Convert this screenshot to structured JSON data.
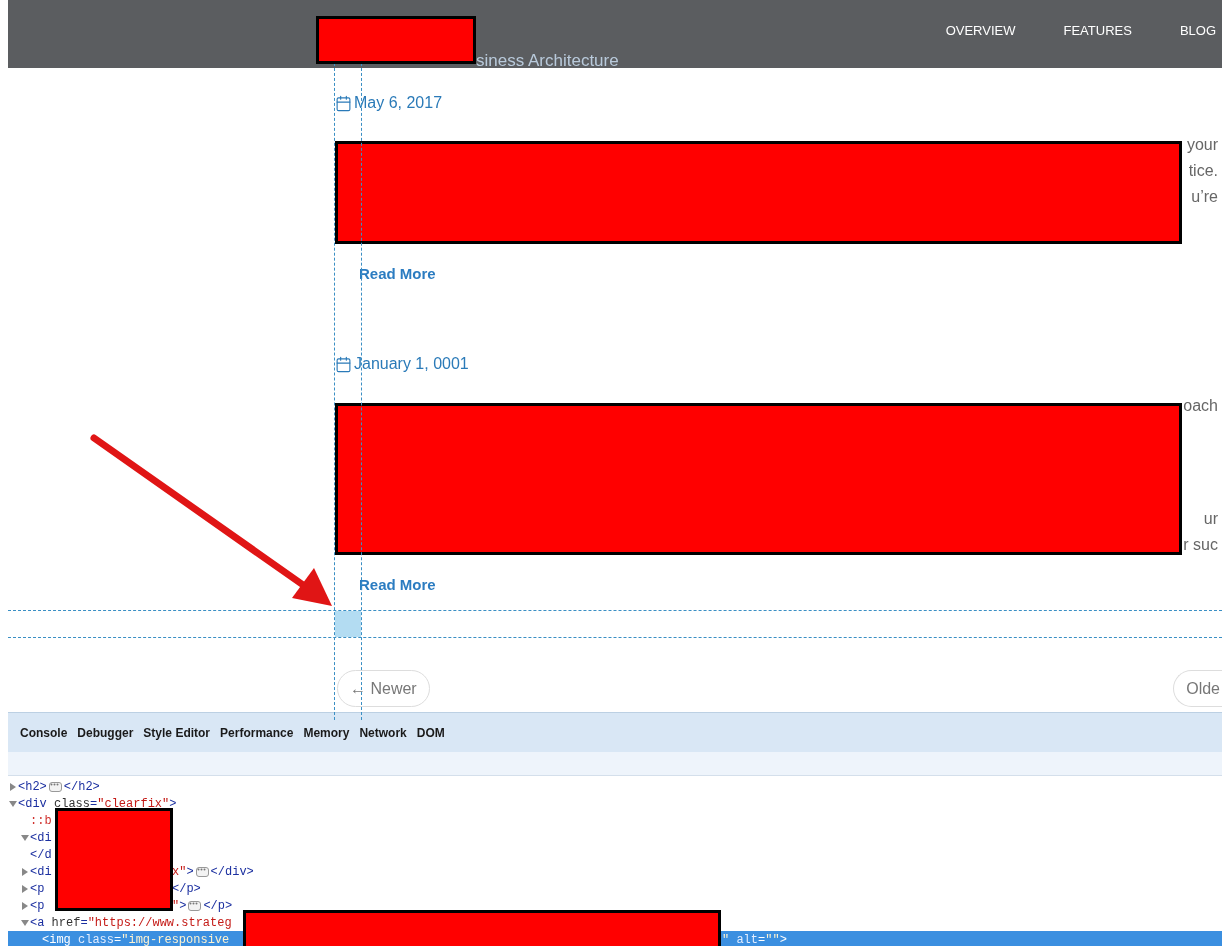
{
  "header": {
    "nav": [
      {
        "label": "OVERVIEW"
      },
      {
        "label": "FEATURES"
      },
      {
        "label": "BLOG"
      }
    ]
  },
  "title_fragment": "siness Architecture",
  "posts": [
    {
      "date": "May 6, 2017",
      "fragment_groups": [
        [
          "your",
          "tice.",
          "u’re"
        ]
      ],
      "read_more": "Read More"
    },
    {
      "date": "January 1, 0001",
      "fragment_groups": [
        [
          "oach"
        ],
        [
          "ur",
          "r suc"
        ]
      ],
      "read_more": "Read More"
    }
  ],
  "pager": {
    "newer": "← Newer",
    "older": "Olde"
  },
  "devtools": {
    "tabs": [
      "Console",
      "Debugger",
      "Style Editor",
      "Performance",
      "Memory",
      "Network",
      "DOM"
    ],
    "lines": [
      {
        "expanded": false,
        "selected": false,
        "head": [
          {
            "kind": "tag",
            "text": "<h2>"
          },
          {
            "kind": "ellipsis"
          },
          {
            "kind": "tag",
            "text": "</h2>"
          }
        ]
      },
      {
        "expanded": true,
        "selected": false,
        "head": [
          {
            "kind": "tag",
            "text": "<div "
          },
          {
            "kind": "attr",
            "text": "class"
          },
          {
            "kind": "tag",
            "text": "="
          },
          {
            "kind": "value",
            "text": "\"clearfix\""
          },
          {
            "kind": "tag",
            "text": ">"
          }
        ],
        "children": [
          {
            "selected": false,
            "head": [
              {
                "kind": "pseudo",
                "text": "::b"
              }
            ]
          },
          {
            "expanded": true,
            "selected": false,
            "head": [
              {
                "kind": "tag",
                "text": "<di"
              }
            ]
          },
          {
            "selected": false,
            "head": [
              {
                "kind": "tag",
                "text": "</d"
              }
            ]
          },
          {
            "expanded": false,
            "selected": false,
            "head": [
              {
                "kind": "tag",
                "text": "<di"
              }
            ],
            "tail": [
              {
                "kind": "value",
                "text": "x\""
              },
              {
                "kind": "tag",
                "text": ">"
              },
              {
                "kind": "ellipsis"
              },
              {
                "kind": "tag",
                "text": "</div>"
              }
            ]
          },
          {
            "expanded": false,
            "selected": false,
            "head": [
              {
                "kind": "tag",
                "text": "<p"
              }
            ],
            "tail": [
              {
                "kind": "tag",
                "text": "</p>"
              }
            ]
          },
          {
            "expanded": false,
            "selected": false,
            "head": [
              {
                "kind": "tag",
                "text": "<p"
              }
            ],
            "tail": [
              {
                "kind": "value",
                "text": "\""
              },
              {
                "kind": "tag",
                "text": ">"
              },
              {
                "kind": "ellipsis"
              },
              {
                "kind": "tag",
                "text": "</p>"
              }
            ]
          },
          {
            "expanded": true,
            "selected": false,
            "head": [
              {
                "kind": "tag",
                "text": "<a "
              },
              {
                "kind": "attr",
                "text": "href"
              },
              {
                "kind": "tag",
                "text": "="
              },
              {
                "kind": "value",
                "text": "\"https://www.strateg"
              }
            ],
            "children": [
              {
                "selected": true,
                "head": [
                  {
                    "kind": "tag",
                    "text": "<img "
                  },
                  {
                    "kind": "attr",
                    "text": "class"
                  },
                  {
                    "kind": "tag",
                    "text": "="
                  },
                  {
                    "kind": "value",
                    "text": "\"img-responsive"
                  }
                ],
                "tail": [
                  {
                    "kind": "value",
                    "text": "\""
                  },
                  {
                    "kind": "attr",
                    "text": " alt"
                  },
                  {
                    "kind": "tag",
                    "text": "="
                  },
                  {
                    "kind": "value",
                    "text": "\"\""
                  },
                  {
                    "kind": "tag",
                    "text": ">"
                  }
                ]
              }
            ]
          }
        ]
      }
    ]
  }
}
